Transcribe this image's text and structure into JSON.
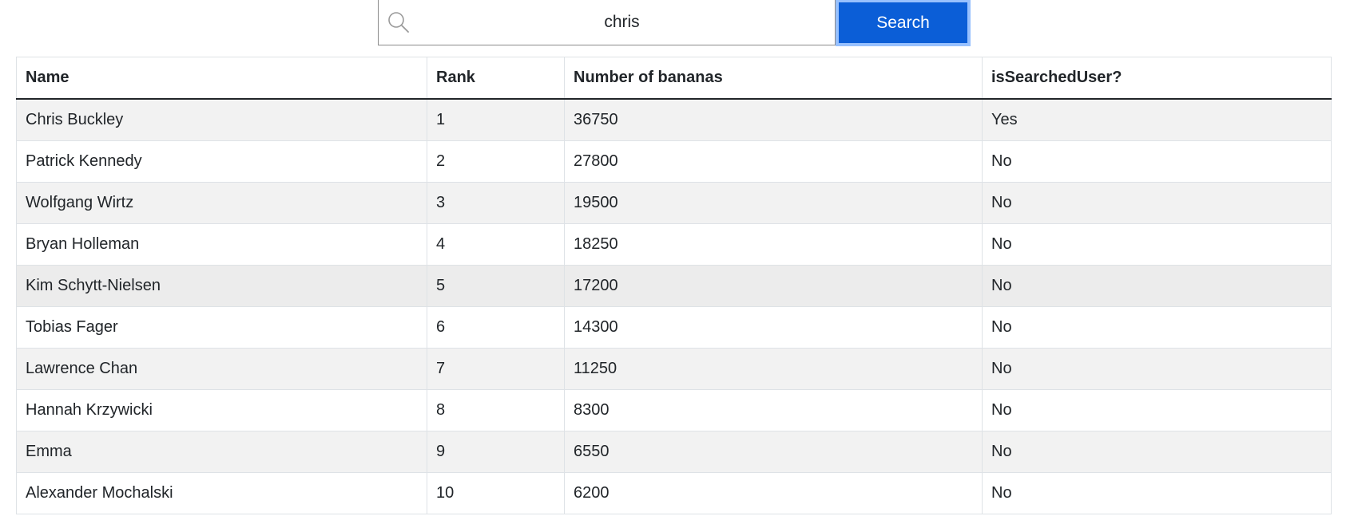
{
  "search": {
    "value": "chris",
    "button_label": "Search",
    "icon": "search-icon"
  },
  "table": {
    "headers": [
      "Name",
      "Rank",
      "Number of bananas",
      "isSearchedUser?"
    ],
    "rows": [
      {
        "name": "Chris Buckley",
        "rank": "1",
        "bananas": "36750",
        "searched": "Yes"
      },
      {
        "name": "Patrick Kennedy",
        "rank": "2",
        "bananas": "27800",
        "searched": "No"
      },
      {
        "name": "Wolfgang Wirtz",
        "rank": "3",
        "bananas": "19500",
        "searched": "No"
      },
      {
        "name": "Bryan Holleman",
        "rank": "4",
        "bananas": "18250",
        "searched": "No"
      },
      {
        "name": "Kim Schytt-Nielsen",
        "rank": "5",
        "bananas": "17200",
        "searched": "No"
      },
      {
        "name": "Tobias Fager",
        "rank": "6",
        "bananas": "14300",
        "searched": "No"
      },
      {
        "name": "Lawrence Chan",
        "rank": "7",
        "bananas": "11250",
        "searched": "No"
      },
      {
        "name": "Hannah Krzywicki",
        "rank": "8",
        "bananas": "8300",
        "searched": "No"
      },
      {
        "name": "Emma",
        "rank": "9",
        "bananas": "6550",
        "searched": "No"
      },
      {
        "name": "Alexander Mochalski",
        "rank": "10",
        "bananas": "6200",
        "searched": "No"
      }
    ]
  },
  "colors": {
    "button_bg": "#0b5ed7",
    "button_focus_ring": "#98c1fe",
    "stripe": "#f2f2f2"
  }
}
